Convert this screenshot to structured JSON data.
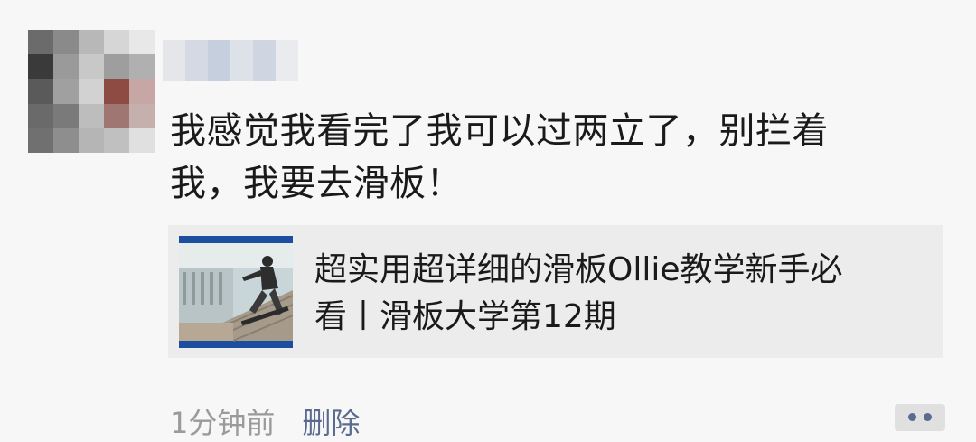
{
  "post": {
    "text_line1": "我感觉我看完了我可以过两立了，别拦着",
    "text_line2": "我，我要去滑板！"
  },
  "link_card": {
    "title_line1": "超实用超详细的滑板Ollie教学新手必",
    "title_line2": "看丨滑板大学第12期"
  },
  "footer": {
    "time": "1分钟前",
    "delete_label": "删除"
  },
  "icons": {
    "avatar": "avatar-image",
    "more": "more-dots-icon",
    "thumbnail": "skateboard-thumbnail"
  }
}
